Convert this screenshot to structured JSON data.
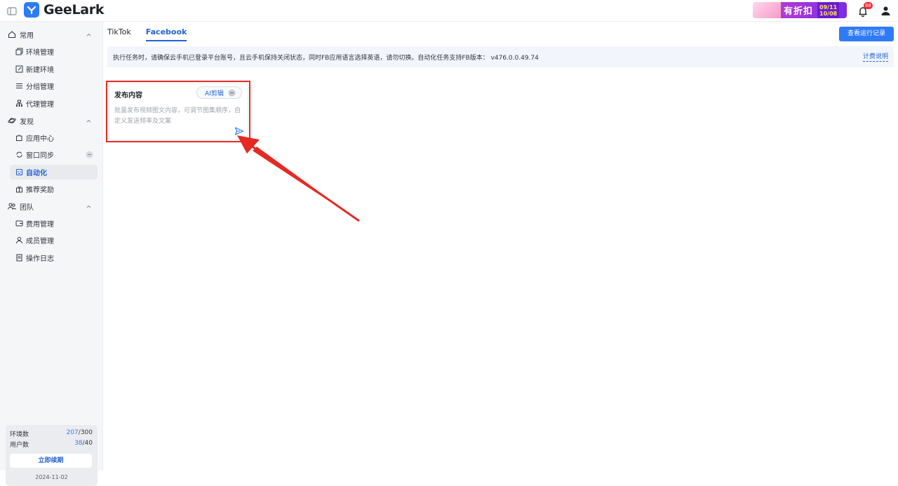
{
  "app": {
    "name": "GeeLark",
    "promo": {
      "title": "有折扣",
      "date_start": "09/11",
      "date_end": "10/08"
    },
    "notifications_count": "88"
  },
  "sidebar": {
    "groups": [
      {
        "label": "常用",
        "icon": "home-icon",
        "items": [
          {
            "label": "环境管理",
            "icon": "copy-icon"
          },
          {
            "label": "新建环境",
            "icon": "edit-icon"
          },
          {
            "label": "分组管理",
            "icon": "list-icon"
          },
          {
            "label": "代理管理",
            "icon": "network-icon"
          }
        ]
      },
      {
        "label": "发现",
        "icon": "planet-icon",
        "items": [
          {
            "label": "应用中心",
            "icon": "puzzle-icon"
          },
          {
            "label": "窗口同步",
            "icon": "sync-icon"
          },
          {
            "label": "自动化",
            "icon": "robot-icon",
            "active": true
          },
          {
            "label": "推荐奖励",
            "icon": "gift-icon"
          }
        ]
      },
      {
        "label": "团队",
        "icon": "team-icon",
        "items": [
          {
            "label": "费用管理",
            "icon": "wallet-icon"
          },
          {
            "label": "成员管理",
            "icon": "member-icon"
          },
          {
            "label": "操作日志",
            "icon": "log-icon"
          }
        ]
      }
    ],
    "quota": {
      "env_label": "环境数",
      "env_used": "207",
      "env_total": "/300",
      "user_label": "用户数",
      "user_used": "38",
      "user_total": "/40",
      "renew_label": "立即续期",
      "expiry_date": "2024-11-02"
    }
  },
  "main": {
    "tabs": [
      {
        "label": "TikTok",
        "active": false
      },
      {
        "label": "Facebook",
        "active": true
      }
    ],
    "run_log_button": "查看运行记录",
    "notice": "执行任务时，请确保云手机已登录平台账号，且云手机保持关闭状态，同时FB应用语言选择英语，请勿切换。自动化任务支持FB版本：  v476.0.0.49.74",
    "notice_link": "计费说明",
    "card": {
      "title": "发布内容",
      "ai_button": "AI剪辑",
      "description": "批量发布视频图文内容，可调节图集顺序，自定义发送频率及文案"
    }
  },
  "colors": {
    "accent": "#2f7bf6",
    "highlight": "#e32b24"
  }
}
